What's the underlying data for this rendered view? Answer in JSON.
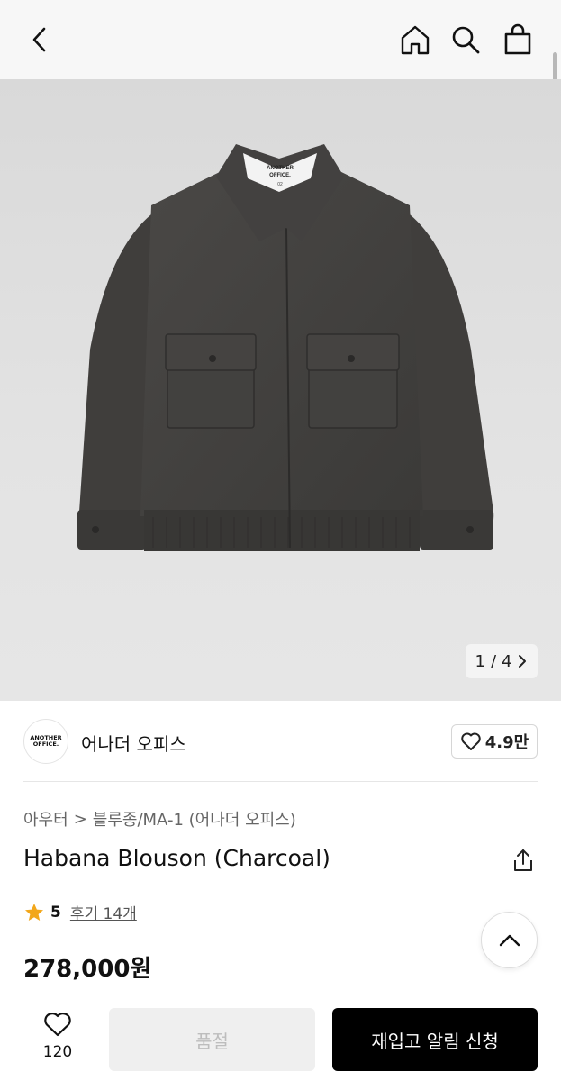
{
  "header": {
    "back_icon": "chevron-left-icon",
    "home_icon": "home-icon",
    "search_icon": "search-icon",
    "bag_icon": "shopping-bag-icon"
  },
  "gallery": {
    "current": "1",
    "separator": "/",
    "total": "4",
    "next_icon": "chevron-right-icon",
    "label_line1": "ANOTHER",
    "label_line2": "OFFICE.",
    "label_size": "02"
  },
  "brand": {
    "logo_line1": "ANOTHER",
    "logo_line2": "OFFICE.",
    "name": "어나더 오피스",
    "likes": "4.9만"
  },
  "breadcrumb": {
    "category": "아우터",
    "separator": ">",
    "subcategory": "블루종/MA-1 (어나더 오피스)"
  },
  "product": {
    "title": "Habana Blouson (Charcoal)",
    "rating": "5",
    "reviews": "후기 14개",
    "price": "278,000원"
  },
  "bottom": {
    "wish_count": "120",
    "soldout_label": "품절",
    "restock_label": "재입고 알림 신청"
  },
  "colors": {
    "accent_star": "#f2a71b",
    "primary_button": "#000000",
    "disabled_button": "#efefef"
  }
}
